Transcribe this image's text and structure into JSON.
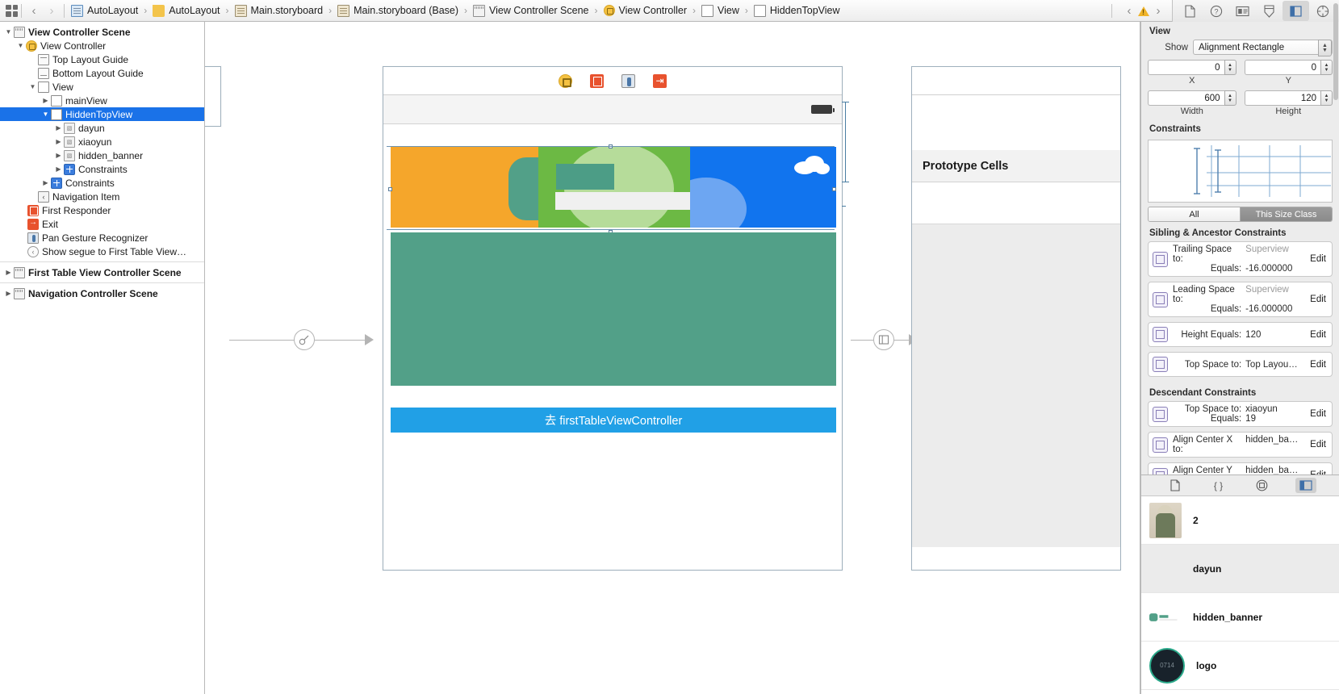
{
  "topbar": {
    "grid_icon": "grid-icon",
    "back_label": "‹",
    "forward_label": "›",
    "breadcrumbs": [
      {
        "label": "AutoLayout",
        "icon": "project-doc-icon"
      },
      {
        "label": "AutoLayout",
        "icon": "folder-icon"
      },
      {
        "label": "Main.storyboard",
        "icon": "storyboard-doc-icon"
      },
      {
        "label": "Main.storyboard (Base)",
        "icon": "storyboard-doc-icon"
      },
      {
        "label": "View Controller Scene",
        "icon": "scene-icon"
      },
      {
        "label": "View Controller",
        "icon": "view-controller-icon"
      },
      {
        "label": "View",
        "icon": "view-square-icon"
      },
      {
        "label": "HiddenTopView",
        "icon": "view-square-icon"
      }
    ],
    "issue_prev": "‹",
    "issue_next": "›",
    "warning_icon": "warning-triangle-icon",
    "inspector_tabs": [
      {
        "name": "file-inspector-tab",
        "glyph": "🗋",
        "active": false
      },
      {
        "name": "quick-help-inspector-tab",
        "glyph": "?",
        "active": false
      },
      {
        "name": "identity-inspector-tab",
        "glyph": "▤",
        "active": false
      },
      {
        "name": "attributes-inspector-tab",
        "glyph": "⬔",
        "active": false
      },
      {
        "name": "size-inspector-tab",
        "glyph": "⊟",
        "active": true
      },
      {
        "name": "connections-inspector-tab",
        "glyph": "⊕",
        "active": false
      }
    ]
  },
  "outline": {
    "items": [
      {
        "label": "View Controller Scene",
        "indent": 0,
        "disclosure": "down",
        "icon": "scene-icon",
        "bold": true,
        "selected": false
      },
      {
        "label": "View Controller",
        "indent": 1,
        "disclosure": "down",
        "icon": "view-controller-icon",
        "bold": false,
        "selected": false
      },
      {
        "label": "Top Layout Guide",
        "indent": 2,
        "disclosure": "none",
        "icon": "top-layout-guide-icon",
        "bold": false,
        "selected": false
      },
      {
        "label": "Bottom Layout Guide",
        "indent": 2,
        "disclosure": "none",
        "icon": "bottom-layout-guide-icon",
        "bold": false,
        "selected": false
      },
      {
        "label": "View",
        "indent": 2,
        "disclosure": "down",
        "icon": "view-square-icon",
        "bold": false,
        "selected": false
      },
      {
        "label": "mainView",
        "indent": 3,
        "disclosure": "right",
        "icon": "view-square-icon",
        "bold": false,
        "selected": false
      },
      {
        "label": "HiddenTopView",
        "indent": 3,
        "disclosure": "down",
        "icon": "view-square-icon",
        "bold": false,
        "selected": true
      },
      {
        "label": "dayun",
        "indent": 4,
        "disclosure": "right",
        "icon": "image-view-icon",
        "bold": false,
        "selected": false
      },
      {
        "label": "xiaoyun",
        "indent": 4,
        "disclosure": "right",
        "icon": "image-view-icon",
        "bold": false,
        "selected": false
      },
      {
        "label": "hidden_banner",
        "indent": 4,
        "disclosure": "right",
        "icon": "image-view-icon",
        "bold": false,
        "selected": false
      },
      {
        "label": "Constraints",
        "indent": 4,
        "disclosure": "right",
        "icon": "constraints-icon",
        "bold": false,
        "selected": false
      },
      {
        "label": "Constraints",
        "indent": 3,
        "disclosure": "right",
        "icon": "constraints-icon",
        "bold": false,
        "selected": false
      },
      {
        "label": "Navigation Item",
        "indent": 3,
        "disclosure": "none",
        "icon": "navigation-item-icon",
        "bold": false,
        "selected": false
      },
      {
        "label": "First Responder",
        "indent": 2,
        "disclosure": "none",
        "icon": "first-responder-icon",
        "bold": false,
        "selected": false
      },
      {
        "label": "Exit",
        "indent": 2,
        "disclosure": "none",
        "icon": "exit-icon",
        "bold": false,
        "selected": false
      },
      {
        "label": "Pan Gesture Recognizer",
        "indent": 2,
        "disclosure": "none",
        "icon": "pan-gesture-icon",
        "bold": false,
        "selected": false
      },
      {
        "label": "Show segue to First Table View…",
        "indent": 2,
        "disclosure": "none",
        "icon": "segue-icon",
        "bold": false,
        "selected": false
      }
    ],
    "scenes": [
      {
        "label": "First Table View Controller Scene",
        "icon": "scene-icon"
      },
      {
        "label": "Navigation Controller Scene",
        "icon": "scene-icon"
      }
    ]
  },
  "canvas": {
    "scene_toolbar_icons": [
      {
        "name": "view-controller-icon"
      },
      {
        "name": "first-responder-icon"
      },
      {
        "name": "pan-gesture-icon"
      },
      {
        "name": "exit-icon"
      }
    ],
    "button_label": "去 firstTableViewController",
    "table_scene": {
      "prototype_cells_label": "Prototype Cells"
    },
    "colors": {
      "orange": "#f5a62b",
      "green": "#6cb944",
      "blue": "#1174ee",
      "teal": "#52a088",
      "button_blue": "#21a0e6",
      "light_green": "#b6dc9a",
      "light_blue": "#6da6f2"
    }
  },
  "inspector": {
    "section_title": "View",
    "show_label": "Show",
    "show_value": "Alignment Rectangle",
    "x_value": "0",
    "x_label": "X",
    "y_value": "0",
    "y_label": "Y",
    "width_value": "600",
    "width_label": "Width",
    "height_value": "120",
    "height_label": "Height",
    "constraints_title": "Constraints",
    "scope_all": "All",
    "scope_size_class": "This Size Class",
    "sibling_title": "Sibling & Ancestor Constraints",
    "descendant_title": "Descendant Constraints",
    "edit_label": "Edit",
    "sibling_constraints": [
      {
        "icon": "trailing-space-constraint-icon",
        "key1": "Trailing Space to:",
        "val1": "Superview",
        "val1_dim": true,
        "key2": "Equals:",
        "val2": "-16.000000"
      },
      {
        "icon": "leading-space-constraint-icon",
        "key1": "Leading Space to:",
        "val1": "Superview",
        "val1_dim": true,
        "key2": "Equals:",
        "val2": "-16.000000"
      },
      {
        "icon": "height-constraint-icon",
        "key1": "Height Equals:",
        "val1": "120",
        "val1_dim": false,
        "key2": "",
        "val2": ""
      },
      {
        "icon": "top-space-constraint-icon",
        "key1": "Top Space to:",
        "val1": "Top Layou…",
        "val1_dim": false,
        "key2": "",
        "val2": ""
      }
    ],
    "descendant_constraints": [
      {
        "icon": "top-space-constraint-icon",
        "key1": "Top Space to:",
        "val1": "xiaoyun",
        "val1_dim": false,
        "key2": "Equals:",
        "val2": "19"
      },
      {
        "icon": "align-center-x-icon",
        "key1": "Align Center X to:",
        "val1": "hidden_ba…",
        "val1_dim": false,
        "key2": "",
        "val2": ""
      },
      {
        "icon": "align-center-y-icon",
        "key1": "Align Center Y to:",
        "val1": "hidden_ba…",
        "val1_dim": false,
        "key2": "",
        "val2": ""
      }
    ]
  },
  "media_library": {
    "tabs": [
      {
        "name": "file-template-library-tab",
        "glyph": "🗋",
        "active": false
      },
      {
        "name": "code-snippet-library-tab",
        "glyph": "{ }",
        "active": false
      },
      {
        "name": "object-library-tab",
        "glyph": "◎",
        "active": false
      },
      {
        "name": "media-library-tab",
        "glyph": "▥",
        "active": true
      }
    ],
    "items": [
      {
        "name": "2",
        "thumb": "person-photo-thumb"
      },
      {
        "name": "dayun",
        "thumb": "cloud-thumb"
      },
      {
        "name": "hidden_banner",
        "thumb": "banner-thumb"
      },
      {
        "name": "logo",
        "thumb": "logo-thumb"
      }
    ]
  }
}
